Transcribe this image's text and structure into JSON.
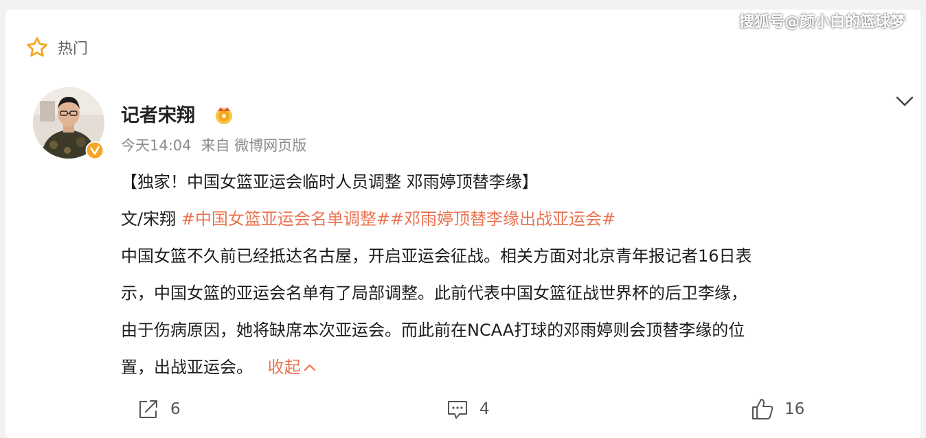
{
  "header": {
    "hot_label": "热门"
  },
  "watermark": "搜狐号@颜小白的篮球梦",
  "post": {
    "author": "记者宋翔",
    "time": "今天14:04",
    "source": "来自 微博网页版",
    "title": "【独家！中国女篮亚运会临时人员调整 邓雨婷顶替李缘】",
    "byline": "文/宋翔",
    "tag1": "#中国女篮亚运会名单调整#",
    "tag2": "#邓雨婷顶替李缘出战亚运会#",
    "body_lines": [
      "中国女篮不久前已经抵达名古屋，开启亚运会征战。相关方面对北京青年报记者16日表",
      "示，中国女篮的亚运会名单有了局部调整。此前代表中国女篮征战世界杯的后卫李缘，",
      "由于伤病原因，她将缺席本次亚运会。而此前在NCAA打球的邓雨婷则会顶替李缘的位",
      "置，出战亚运会。"
    ],
    "collapse_label": "收起"
  },
  "actions": {
    "share_count": "6",
    "comment_count": "4",
    "like_count": "16"
  },
  "colors": {
    "accent": "#eb7350",
    "star": "#f5a623",
    "verified": "#f5a623"
  },
  "icons": [
    "star-icon",
    "chevron-down-icon",
    "verified-icon",
    "crown-badge-icon",
    "share-icon",
    "comment-icon",
    "like-icon",
    "chevron-up-icon"
  ]
}
